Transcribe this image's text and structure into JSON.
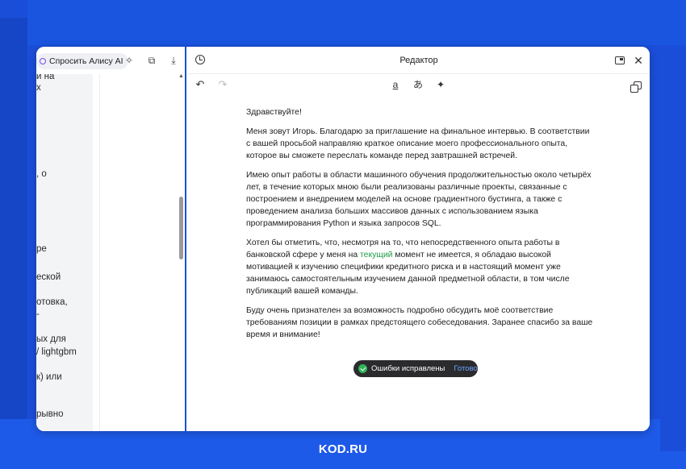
{
  "brand": "KOD.RU",
  "sidebar": {
    "alice_button": "Спросить Алису AI",
    "text_fragments": [
      "й на",
      "х",
      ", о",
      "ре",
      "еской",
      "отовка,",
      "-",
      "ых для",
      "/ lightgbm",
      "к) или",
      "рывно"
    ]
  },
  "editor": {
    "title": "Редактор",
    "greeting": "Здравствуйте!",
    "paragraph1": "Меня зовут Игорь. Благодарю за приглашение на финальное интервью. В соответствии с вашей просьбой направляю краткое описание моего профессионального опыта, которое вы сможете переслать команде перед завтрашней встречей.",
    "paragraph2": "Имею опыт работы в области машинного обучения продолжительностью около четырёх лет, в течение которых мною были реализованы различные проекты, связанные с построением и внедрением моделей на основе градиентного бустинга, а также с проведением анализа больших массивов данных с использованием языка программирования Python и языка запросов SQL.",
    "paragraph3_before": "Хотел бы отметить, что, несмотря на то, что непосредственного опыта работы в банковской сфере у меня на ",
    "paragraph3_highlight": "текущий",
    "paragraph3_after": " момент не имеется, я обладаю высокой мотивацией к изучению специфики кредитного риска и в настоящий момент уже занимаюсь самостоятельным изучением данной предметной области, в том числе публикаций вашей команды.",
    "paragraph4": "Буду очень признателен за возможность подробно обсудить моё соответствие требованиям позиции в рамках предстоящего собеседования. Заранее спасибо за ваше время и внимание!",
    "highlight_color": "#1c9b44"
  },
  "toast": {
    "message": "Ошибки исправлены",
    "action": "Готово"
  }
}
